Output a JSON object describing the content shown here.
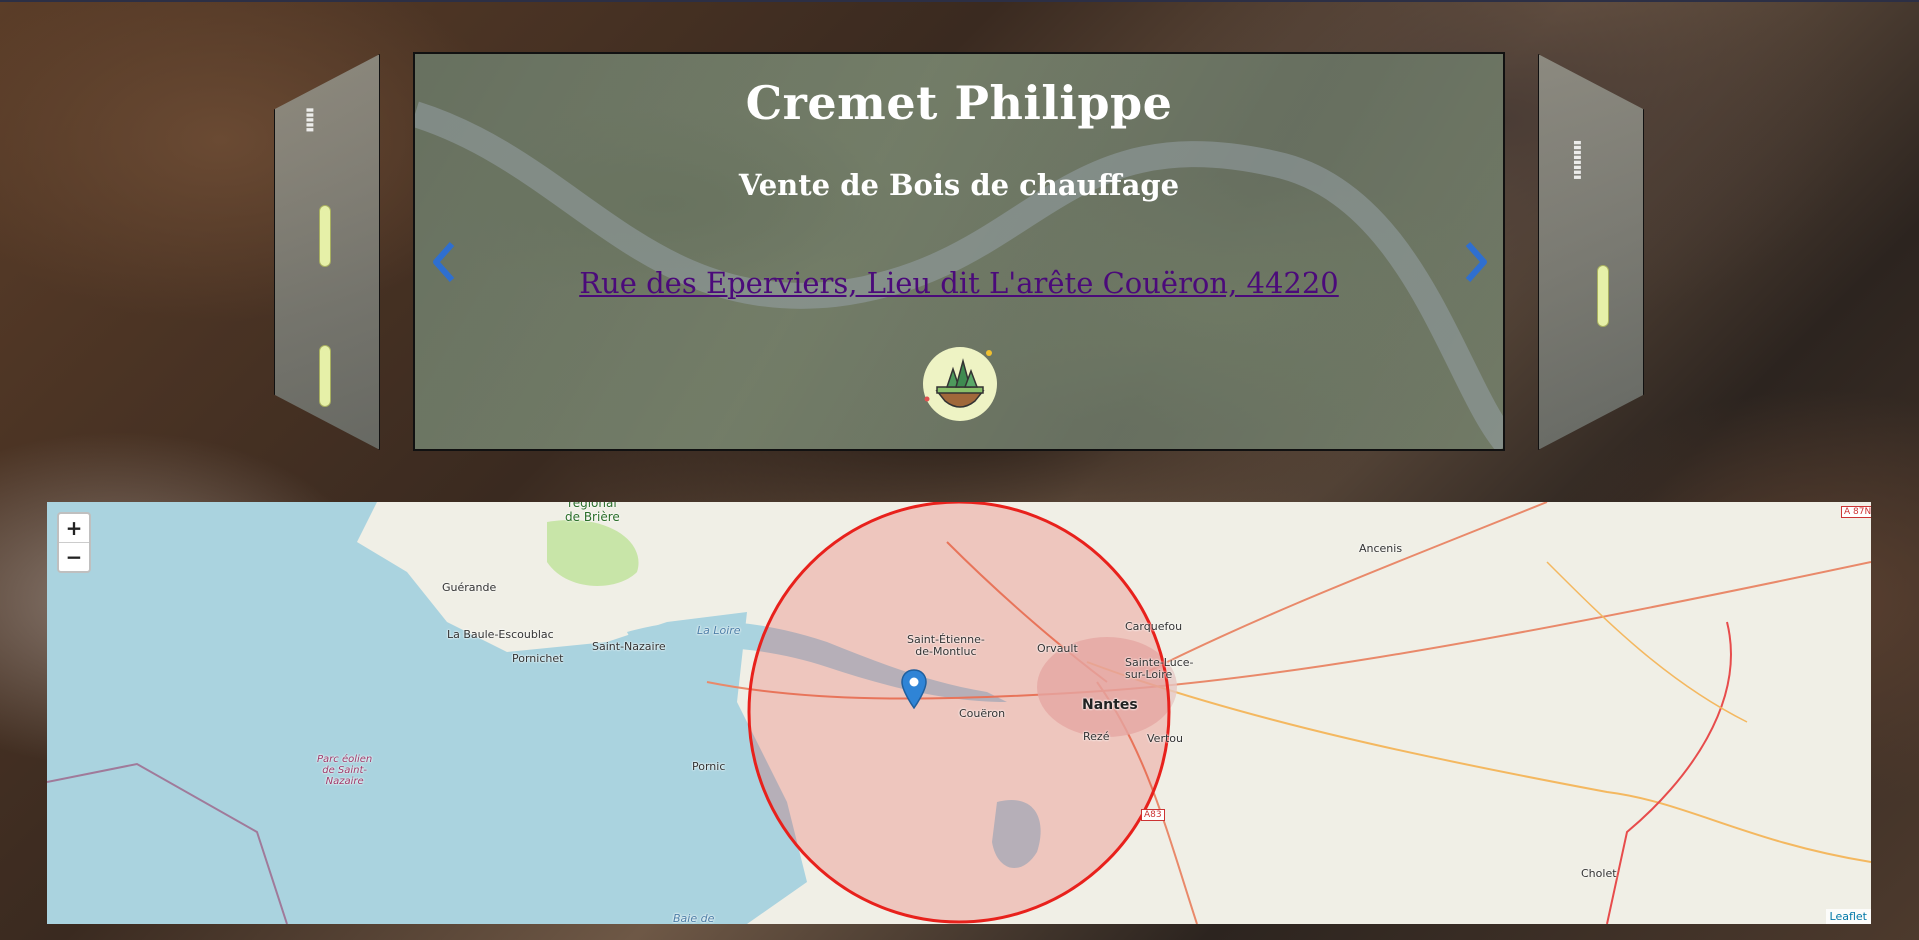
{
  "carousel": {
    "title": "Cremet Philippe",
    "subtitle": "Vente de Bois de chauffage",
    "address": "Rue des Eperviers, Lieu dit L'arête Couëron, 44220",
    "logo_icon": "tree-island-logo-icon",
    "prev_icon": "chevron-left-icon",
    "next_icon": "chevron-right-icon",
    "arrow_color": "#2f6fd0",
    "address_color": "#4b0a7a"
  },
  "map": {
    "zoom_in": "+",
    "zoom_out": "−",
    "attribution": "Leaflet",
    "circle_color": "#e8211c",
    "marker_icon": "map-pin-icon",
    "labels": {
      "briere": "régional\nde Brière",
      "guerande": "Guérande",
      "labaule": "La Baule-Escoublac",
      "pornichet": "Pornichet",
      "saintnazaire": "Saint-Nazaire",
      "laloire": "La Loire",
      "sainetienne": "Saint-Étienne-\nde-Montluc",
      "coueron": "Couëron",
      "orvault": "Orvault",
      "nantes": "Nantes",
      "reze": "Rezé",
      "carquefou": "Carquefou",
      "saintelucie": "Sainte-Luce-\nsur-Loire",
      "vertou": "Vertou",
      "ancenis": "Ancenis",
      "cholet": "Cholet",
      "pornic": "Pornic",
      "parc_eolien": "Parc éolien\nde Saint-\nNazaire",
      "baie": "Baie de",
      "a87": "A 87N",
      "a83": "A83"
    }
  }
}
